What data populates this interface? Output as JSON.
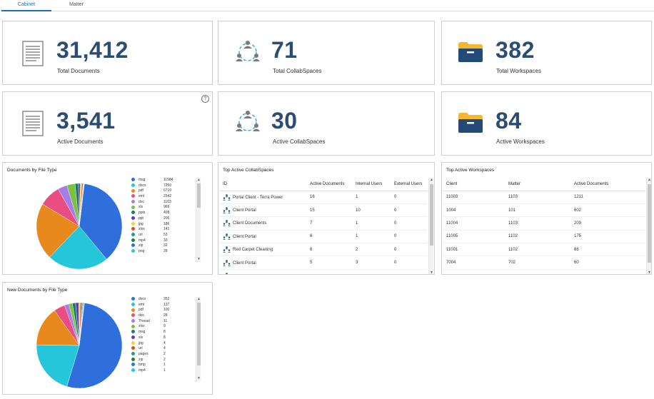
{
  "tabs": [
    {
      "label": "Cabinet",
      "active": true
    },
    {
      "label": "Matter",
      "active": false
    }
  ],
  "stats": {
    "total_documents": {
      "value": "31,412",
      "label": "Total Documents"
    },
    "total_collabspaces": {
      "value": "71",
      "label": "Total CollabSpaces"
    },
    "total_workspaces": {
      "value": "382",
      "label": "Total Workspaces"
    },
    "active_documents": {
      "value": "3,541",
      "label": "Active Documents"
    },
    "active_collabspaces": {
      "value": "30",
      "label": "Active CollabSpaces"
    },
    "active_workspaces": {
      "value": "84",
      "label": "Active Workspaces"
    }
  },
  "help_label": "?",
  "colors": {
    "accent": "#1e6bb8",
    "stat_value": "#2b4d73",
    "folder_top": "#f5b731",
    "folder_body": "#244b78"
  },
  "documents_by_type": {
    "title": "Documents by File Type",
    "chart_data": {
      "type": "pie",
      "title": "Documents by File Type",
      "slices": [
        {
          "label": "msg",
          "value": 11584,
          "color": "#2f6fdc"
        },
        {
          "label": "docx",
          "value": 7250,
          "color": "#26c6da"
        },
        {
          "label": "pdf",
          "value": 6710,
          "color": "#e8891e"
        },
        {
          "label": "eml",
          "value": 2542,
          "color": "#e94d82"
        },
        {
          "label": "doc",
          "value": 1103,
          "color": "#a67ce8"
        },
        {
          "label": "xls",
          "value": 969,
          "color": "#7cc241"
        },
        {
          "label": "pptx",
          "value": 408,
          "color": "#1a7a6b"
        },
        {
          "label": "ppt",
          "value": 206,
          "color": "#5b3fb5"
        },
        {
          "label": "jpg",
          "value": 186,
          "color": "#f4d03f"
        },
        {
          "label": "xlsx",
          "value": 141,
          "color": "#d94a2b"
        },
        {
          "label": "url",
          "value": 53,
          "color": "#1c9e8a"
        },
        {
          "label": "mp4",
          "value": 33,
          "color": "#2e7d32"
        },
        {
          "label": "zip",
          "value": 32,
          "color": "#2f6fdc"
        },
        {
          "label": "png",
          "value": 28,
          "color": "#26c6da"
        }
      ]
    }
  },
  "new_documents_by_type": {
    "title": "New Documents by File Type",
    "chart_data": {
      "type": "pie",
      "title": "New Documents by File Type",
      "slices": [
        {
          "label": "docx",
          "value": 352,
          "color": "#2f6fdc"
        },
        {
          "label": "eml",
          "value": 137,
          "color": "#26c6da"
        },
        {
          "label": "pdf",
          "value": 100,
          "color": "#e8891e"
        },
        {
          "label": "doc",
          "value": 28,
          "color": "#e94d82"
        },
        {
          "label": "Thread",
          "value": 11,
          "color": "#a67ce8"
        },
        {
          "label": "xlsx",
          "value": 9,
          "color": "#7cc241"
        },
        {
          "label": "msg",
          "value": 8,
          "color": "#1a7a6b"
        },
        {
          "label": "xls",
          "value": 8,
          "color": "#5b3fb5"
        },
        {
          "label": "jpg",
          "value": 4,
          "color": "#f4d03f"
        },
        {
          "label": "url",
          "value": 4,
          "color": "#d94a2b"
        },
        {
          "label": "pages",
          "value": 2,
          "color": "#1c9e8a"
        },
        {
          "label": "zip",
          "value": 2,
          "color": "#2e7d32"
        },
        {
          "label": "bmp",
          "value": 1,
          "color": "#2f6fdc"
        },
        {
          "label": "mp4",
          "value": 1,
          "color": "#26c6da"
        }
      ]
    }
  },
  "top_collabspaces": {
    "title": "Top Active CollabSpaces",
    "columns": [
      "ID",
      "Active Documents",
      "Internal Users",
      "External Users"
    ],
    "rows": [
      [
        "Portal Client - Terra Power",
        "16",
        "1",
        "0"
      ],
      [
        "Client Portal",
        "15",
        "10",
        "0"
      ],
      [
        "Client Documents",
        "7",
        "1",
        "0"
      ],
      [
        "Client Portal",
        "6",
        "1",
        "0"
      ],
      [
        "Red Carpet Cleaning",
        "6",
        "2",
        "0"
      ],
      [
        "Client Portal",
        "5",
        "3",
        "0"
      ],
      [
        "Client Documents",
        "5",
        "1",
        "0"
      ]
    ]
  },
  "top_workspaces": {
    "title": "Top Active Workspaces",
    "columns": [
      "Client",
      "Matter",
      "Active Documents"
    ],
    "rows": [
      [
        "11003",
        "1103",
        "1211"
      ],
      [
        "1004",
        "101",
        "602"
      ],
      [
        "11004",
        "1103",
        "209"
      ],
      [
        "11005",
        "1102",
        "175"
      ],
      [
        "11001",
        "1102",
        "66"
      ],
      [
        "7004",
        "702",
        "60"
      ],
      [
        "4001",
        "402",
        "54"
      ]
    ]
  }
}
